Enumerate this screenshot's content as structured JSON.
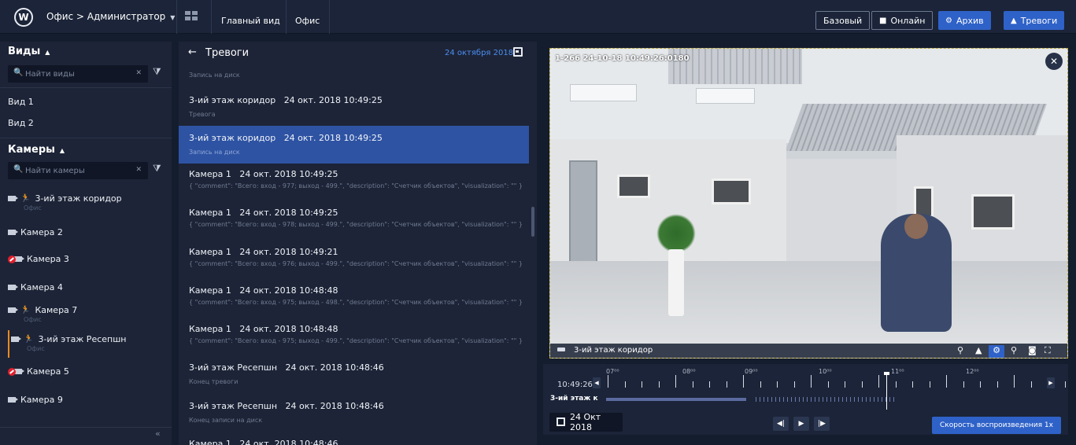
{
  "topbar": {
    "logo": "W",
    "breadcrumb": "Офис > Администратор",
    "tabs": [
      "Главный вид",
      "Офис"
    ],
    "buttons": {
      "basic": "Базовый",
      "online": "Онлайн",
      "archive": "Архив",
      "alarms": "Тревоги"
    }
  },
  "sidebar": {
    "views_title": "Виды",
    "views_search_placeholder": "Найти виды",
    "views": [
      "Вид 1",
      "Вид 2"
    ],
    "cameras_title": "Камеры",
    "cameras_search_placeholder": "Найти камеры",
    "cameras": [
      {
        "name": "3-ий этаж коридор",
        "sub": "Офис"
      },
      {
        "name": "Камера 2",
        "sub": ""
      },
      {
        "name": "Камера 3",
        "sub": ""
      },
      {
        "name": "Камера 4",
        "sub": ""
      },
      {
        "name": "Камера 7",
        "sub": "Офис"
      },
      {
        "name": "3-ий этаж Ресепшн",
        "sub": "Офис"
      },
      {
        "name": "Камера 5",
        "sub": ""
      },
      {
        "name": "Камера 9",
        "sub": ""
      }
    ],
    "collapse_glyph": "«"
  },
  "events": {
    "title": "Тревоги",
    "date": "24 октября 2018",
    "first_detail": "Запись на диск",
    "items": [
      {
        "source": "3-ий этаж коридор",
        "time": "24 окт. 2018 10:49:25",
        "detail": "Тревога"
      },
      {
        "source": "3-ий этаж коридор",
        "time": "24 окт. 2018 10:49:25",
        "detail": "Запись на диск"
      },
      {
        "source": "Камера 1",
        "time": "24 окт. 2018 10:49:25",
        "detail": "{ \"comment\": \"Всего: вход - 977; выход - 499.\", \"description\": \"Счетчик объектов\", \"visualization\": \"\" }"
      },
      {
        "source": "Камера 1",
        "time": "24 окт. 2018 10:49:25",
        "detail": "{ \"comment\": \"Всего: вход - 978; выход - 499.\", \"description\": \"Счетчик объектов\", \"visualization\": \"\" }"
      },
      {
        "source": "Камера 1",
        "time": "24 окт. 2018 10:49:21",
        "detail": "{ \"comment\": \"Всего: вход - 976; выход - 499.\", \"description\": \"Счетчик объектов\", \"visualization\": \"\" }"
      },
      {
        "source": "Камера 1",
        "time": "24 окт. 2018 10:48:48",
        "detail": "{ \"comment\": \"Всего: вход - 975; выход - 498.\", \"description\": \"Счетчик объектов\", \"visualization\": \"\" }"
      },
      {
        "source": "Камера 1",
        "time": "24 окт. 2018 10:48:48",
        "detail": "{ \"comment\": \"Всего: вход - 975; выход - 499.\", \"description\": \"Счетчик объектов\", \"visualization\": \"\" }"
      },
      {
        "source": "3-ий этаж Ресепшн",
        "time": "24 окт. 2018 10:48:46",
        "detail": "Конец тревоги"
      },
      {
        "source": "3-ий этаж Ресепшн",
        "time": "24 окт. 2018 10:48:46",
        "detail": "Конец записи на диск"
      },
      {
        "source": "Камера 1",
        "time": "24 окт. 2018 10:48:46",
        "detail": ""
      }
    ]
  },
  "video": {
    "stamp": "1-266 24-10-18 10:49:26:0180",
    "camera_label": "3-ий этаж коридор",
    "close_glyph": "✕"
  },
  "timeline": {
    "hours": [
      "07⁰⁰",
      "08⁰⁰",
      "09⁰⁰",
      "10⁰⁰",
      "11⁰⁰",
      "12⁰⁰"
    ],
    "current_time": "10:49:26",
    "camera": "3-ий этаж к",
    "date": "24 Окт 2018",
    "speed": "Скорость воспроизведения 1x"
  }
}
